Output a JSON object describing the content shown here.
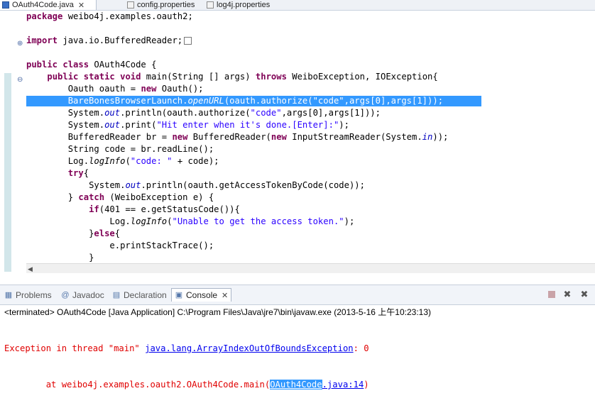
{
  "editor_tabs": [
    {
      "label": "OAuth4Code.java",
      "active": true,
      "icon": "java-file-icon",
      "close": "✕"
    },
    {
      "label": "config.properties",
      "active": false,
      "icon": "properties-file-icon"
    },
    {
      "label": "log4j.properties",
      "active": false,
      "icon": "properties-file-icon"
    }
  ],
  "code": {
    "l1": {
      "k": "package",
      "t": " weibo4j.examples.oauth2;"
    },
    "l3": {
      "k": "import",
      "t": " java.io.BufferedReader;"
    },
    "l5": {
      "k1": "public",
      "k2": "class",
      "t": " OAuth4Code {"
    },
    "l6": {
      "k1": "public",
      "k2": "static",
      "k3": "void",
      "t1": " main(String [] args) ",
      "k4": "throws",
      "t2": " WeiboException, IOException{"
    },
    "l7": {
      "t1": "Oauth oauth = ",
      "k": "new",
      "t2": " Oauth();"
    },
    "l8": {
      "t1": "BareBonesBrowserLaunch.",
      "i": "openURL",
      "t2": "(oauth.authorize(",
      "s": "\"code\"",
      "t3": ",args[0],args[1]));"
    },
    "l9": {
      "t1": "System.",
      "f": "out",
      "t2": ".println(oauth.authorize(",
      "s": "\"code\"",
      "t3": ",args[0],args[1]));"
    },
    "l10": {
      "t1": "System.",
      "f": "out",
      "t2": ".print(",
      "s": "\"Hit enter when it's done.[Enter]:\"",
      "t3": ");"
    },
    "l11": {
      "t1": "BufferedReader br = ",
      "k1": "new",
      "t2": " BufferedReader(",
      "k2": "new",
      "t3": " InputStreamReader(System.",
      "f": "in",
      "t4": "));"
    },
    "l12": {
      "t": "String code = br.readLine();"
    },
    "l13": {
      "t1": "Log.",
      "i": "logInfo",
      "t2": "(",
      "s": "\"code: \"",
      "t3": " + code);"
    },
    "l14": {
      "k": "try",
      "t": "{"
    },
    "l15": {
      "t1": "System.",
      "f": "out",
      "t2": ".println(oauth.getAccessTokenByCode(code));"
    },
    "l16": {
      "t1": "} ",
      "k": "catch",
      "t2": " (WeiboException e) {"
    },
    "l17": {
      "k": "if",
      "t": "(401 == e.getStatusCode()){"
    },
    "l18": {
      "t1": "Log.",
      "i": "logInfo",
      "t2": "(",
      "s": "\"Unable to get the access token.\"",
      "t3": ");"
    },
    "l19": {
      "t1": "}",
      "k": "else",
      "t2": "{"
    },
    "l20": {
      "t": "e.printStackTrace();"
    },
    "l21": {
      "t": "}"
    }
  },
  "panel_tabs": [
    {
      "label": "Problems",
      "icon": "problems-icon"
    },
    {
      "label": "Javadoc",
      "icon": "javadoc-icon",
      "glyph": "@"
    },
    {
      "label": "Declaration",
      "icon": "declaration-icon"
    },
    {
      "label": "Console",
      "icon": "console-icon",
      "active": true,
      "close": "✕"
    }
  ],
  "console": {
    "header": "<terminated> OAuth4Code [Java Application] C:\\Program Files\\Java\\jre7\\bin\\javaw.exe (2013-5-16 上午10:23:13)",
    "e1": "Exception in thread \"main\" ",
    "e1_link": "java.lang.ArrayIndexOutOfBoundsException",
    "e1_tail": ": 0",
    "e2": "        at weibo4j.examples.oauth2.OAuth4Code.main(",
    "e2_sel": "OAuth4Code",
    "e2_link": ".java:14",
    "e2_tail": ")"
  },
  "colors": {
    "keyword": "#7f0055",
    "string": "#2a00ff",
    "field": "#0000c0",
    "selection": "#3399ff",
    "error": "#e00000"
  }
}
